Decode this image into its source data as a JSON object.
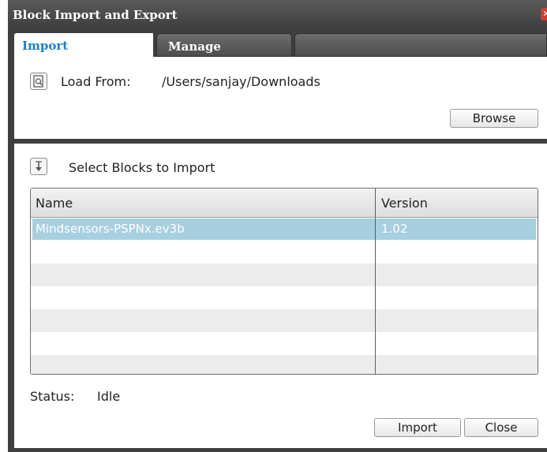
{
  "window": {
    "title": "Block Import and Export"
  },
  "tabs": [
    {
      "label": "Import",
      "active": true
    },
    {
      "label": "Manage",
      "active": false
    }
  ],
  "load": {
    "label": "Load From:",
    "path": "/Users/sanjay/Downloads",
    "browse_label": "Browse",
    "icon": "file-search-icon"
  },
  "select": {
    "label": "Select Blocks to Import",
    "icon": "download-arrow-icon"
  },
  "table": {
    "columns": [
      "Name",
      "Version"
    ],
    "rows": [
      {
        "name": "Mindsensors-PSPNx.ev3b",
        "version": "1.02",
        "selected": true
      }
    ]
  },
  "status": {
    "label": "Status:",
    "value": "Idle"
  },
  "buttons": {
    "import_label": "Import",
    "close_label": "Close"
  },
  "colors": {
    "accent_tab": "#1a7fd0",
    "selection": "#a7cfe0",
    "frame": "#3f3f3f",
    "close": "#d33c2c"
  }
}
